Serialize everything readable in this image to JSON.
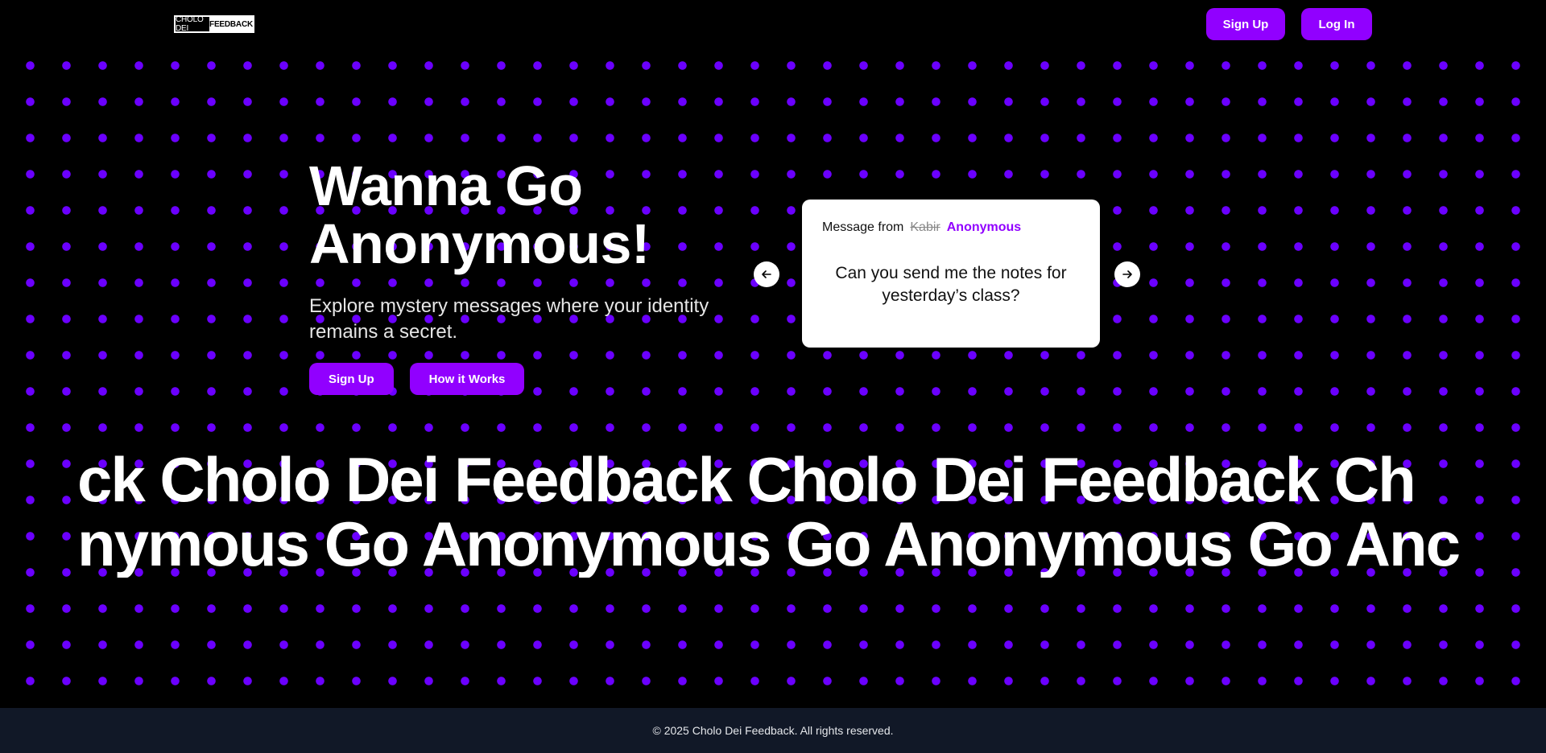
{
  "nav": {
    "logo_left": "CHOLO DEI",
    "logo_right": "FEEDBACK",
    "signup_label": "Sign Up",
    "login_label": "Log In"
  },
  "hero": {
    "title_line1": "Wanna Go",
    "title_line2": "Anonymous!",
    "subtitle": "Explore mystery messages where your identity remains a secret.",
    "signup_label": "Sign Up",
    "how_label": "How it Works"
  },
  "carousel": {
    "prev_icon": "arrow-left-icon",
    "next_icon": "arrow-right-icon",
    "card": {
      "from_label": "Message from",
      "struck_name": "Kabir",
      "sender": "Anonymous",
      "message": "Can you send me the notes for yesterday’s class?"
    }
  },
  "marquee": {
    "line1": "ck Cholo Dei Feedback Cholo Dei Feedback Ch",
    "line2": "nymous Go Anonymous Go Anonymous Go Anc"
  },
  "footer": {
    "text": "© 2025 Cholo Dei Feedback. All rights reserved."
  },
  "colors": {
    "accent": "#9100ff",
    "dots": "#6b00ff",
    "background": "#000000",
    "footer_bg": "#111827"
  }
}
